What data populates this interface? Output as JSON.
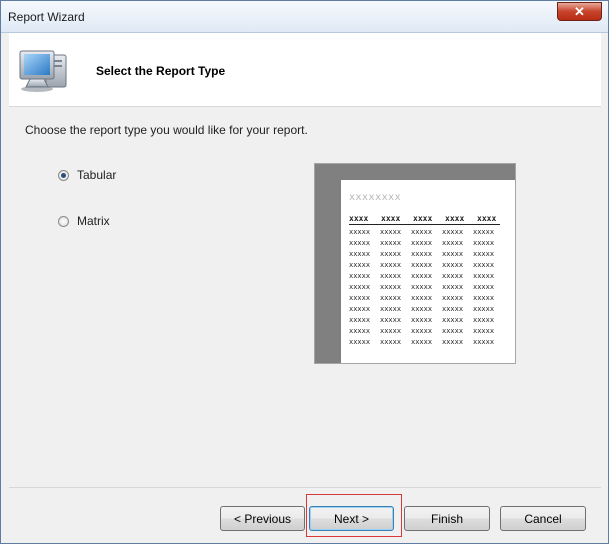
{
  "window": {
    "title": "Report Wizard"
  },
  "header": {
    "title": "Select the Report Type",
    "icon": "computer-monitor-icon"
  },
  "main": {
    "prompt": "Choose the report type you would like for your report.",
    "options": [
      {
        "label": "Tabular",
        "selected": true
      },
      {
        "label": "Matrix",
        "selected": false
      }
    ]
  },
  "preview": {
    "title": "xxxxxxxx",
    "header_cells": [
      "xxxx",
      "xxxx",
      "xxxx",
      "xxxx",
      "xxxx"
    ],
    "cell": "xxxxx",
    "columns": 5,
    "rows": 11
  },
  "footer": {
    "previous_label": "< Previous",
    "next_label": "Next >",
    "finish_label": "Finish",
    "cancel_label": "Cancel"
  },
  "colors": {
    "title_bar": "#dfe9f5",
    "close_button": "#c7432b",
    "highlight_border": "#d63a3a",
    "preview_background": "#808080"
  }
}
